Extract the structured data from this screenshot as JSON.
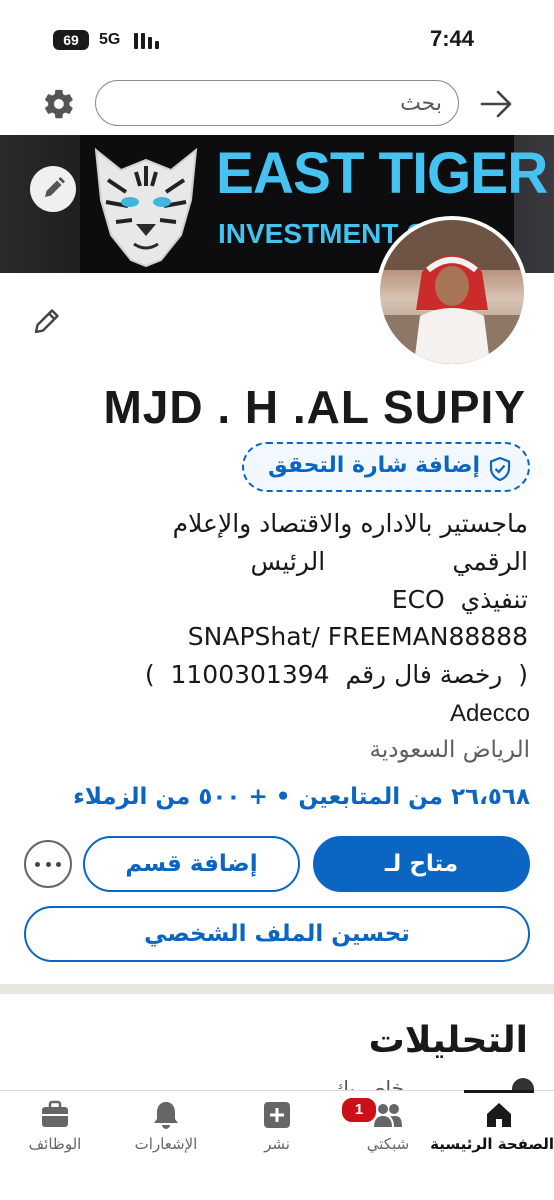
{
  "status_bar": {
    "time": "7:44",
    "battery": "69",
    "network": "5G"
  },
  "search": {
    "placeholder": "بحث"
  },
  "banner": {
    "title_line1": "EAST TIGER",
    "title_line2": "INVESTMENT C"
  },
  "profile": {
    "name": "MJD . H .AL SUPIY",
    "verify_label": "إضافة شارة التحقق",
    "headline_lines": [
      "ماجستير بالاداره والاقتصاد والإعلام",
      "الرقمي                الرئيس",
      "تنفيذي  ECO",
      "SNAPShat/ FREEMAN88888",
      "(  رخصة فال رقم  1100301394  )"
    ],
    "company": "Adecco",
    "location": "الرياض السعودية",
    "connections": "٢٦،٥٦٨ من المتابعين • + ٥٠٠ من الزملاء"
  },
  "actions": {
    "open_to": "متاح لـ",
    "add_section": "إضافة قسم",
    "improve_profile": "تحسين الملف الشخصي"
  },
  "analytics": {
    "title": "التحليلات",
    "peek_text": "خاص بك"
  },
  "bottom_nav": {
    "home": "الصفحة الرئيسية",
    "network": "شبكتي",
    "network_badge": "1",
    "post": "نشر",
    "notifications": "الإشعارات",
    "jobs": "الوظائف"
  },
  "colors": {
    "accent": "#0a66c2",
    "banner_text": "#45c2ef",
    "badge": "#cc1016"
  }
}
